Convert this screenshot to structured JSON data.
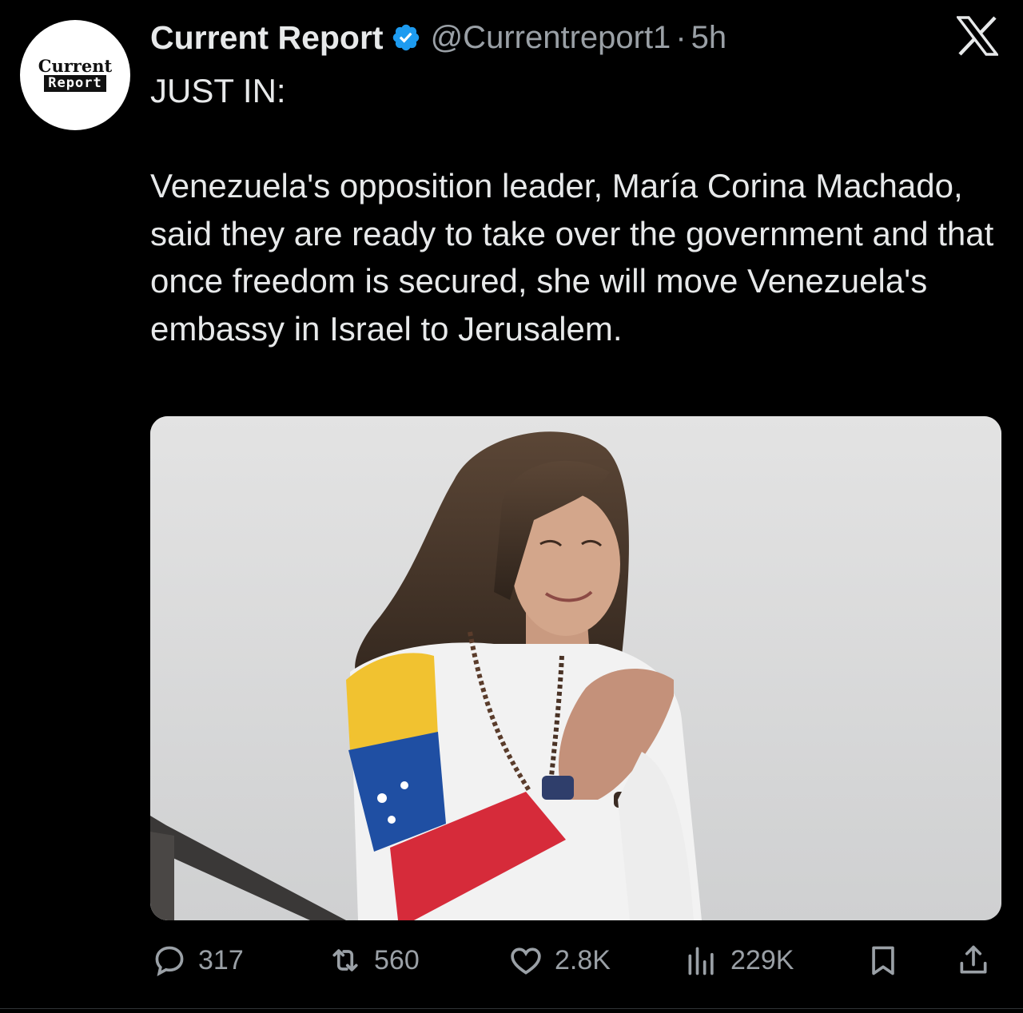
{
  "author": {
    "display_name": "Current Report",
    "handle": "@Currentreport1",
    "separator": "·",
    "time": "5h",
    "avatar_logo_top": "Current",
    "avatar_logo_bottom": "Report",
    "verified": true
  },
  "tweet": {
    "lead": "JUST IN:",
    "body": "Venezuela's opposition leader, María Corina Machado, said they are ready to take over the government and that once freedom is secured, she will move Venezuela's embassy in Israel to Jerusalem."
  },
  "media": {
    "type": "photo"
  },
  "metrics": {
    "replies": "317",
    "reposts": "560",
    "likes": "2.8K",
    "views": "229K"
  },
  "icons": {
    "platform": "x-logo-icon",
    "verified": "verified-badge-icon",
    "reply": "reply-icon",
    "repost": "repost-icon",
    "like": "heart-icon",
    "views": "views-icon",
    "bookmark": "bookmark-icon",
    "share": "share-icon"
  },
  "colors": {
    "background": "#000000",
    "text": "#e7e9ea",
    "secondary_text": "#9aa0a6",
    "verified_blue": "#1d9bf0"
  }
}
